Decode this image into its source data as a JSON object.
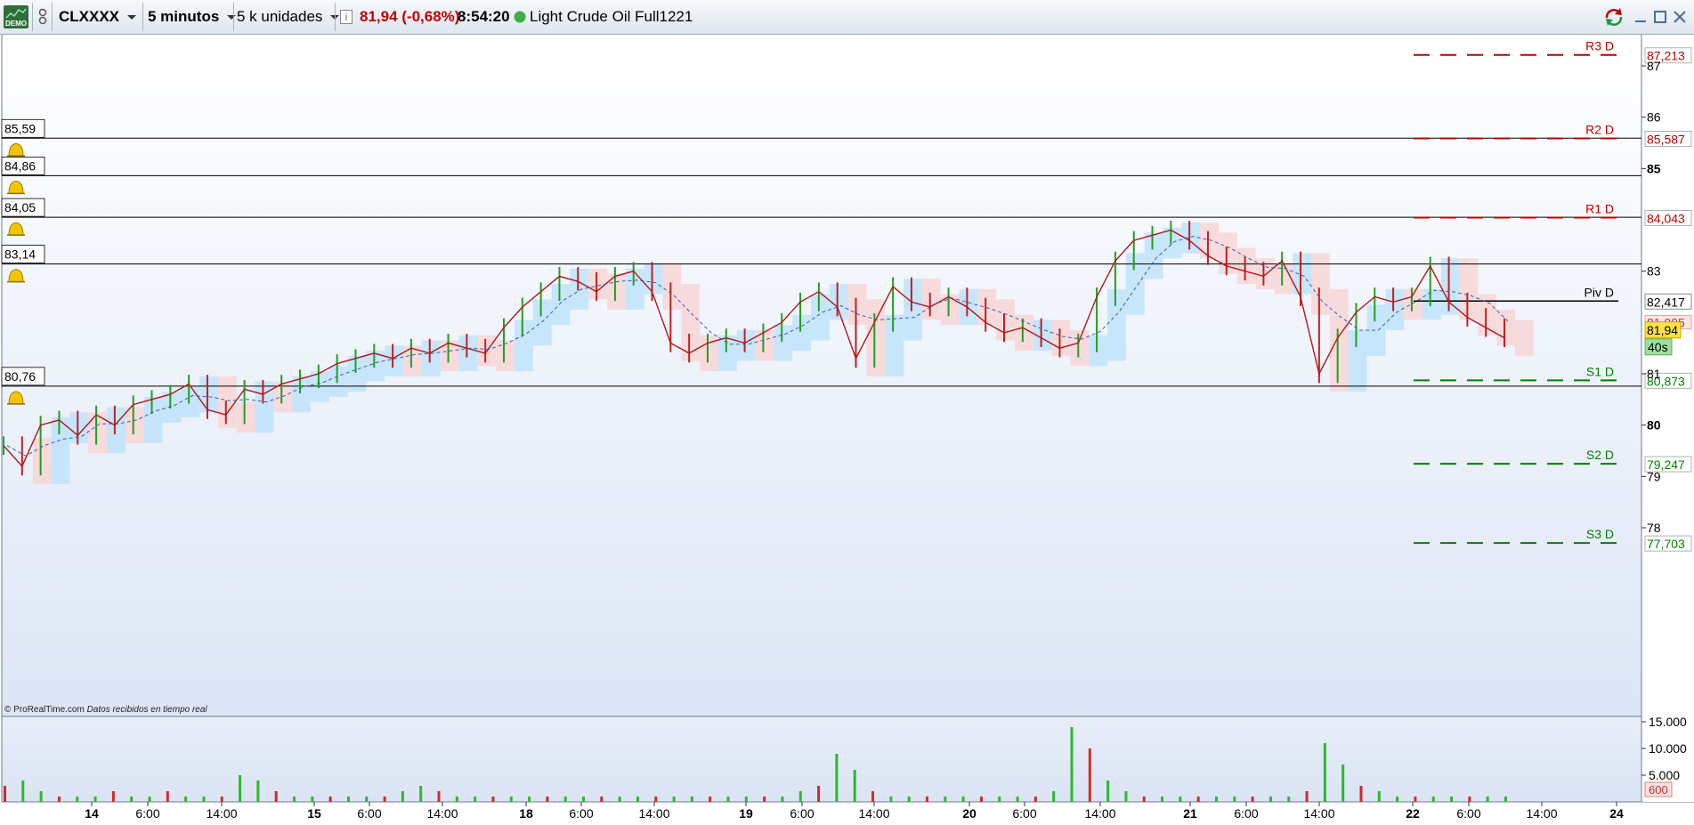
{
  "toolbar": {
    "demo_label": "DEMO",
    "symbol": "CLXXXX",
    "timeframe": "5 minutos",
    "units": "5 k unidades",
    "price_change": "81,94 (-0,68%)",
    "time": "8:54:20",
    "instrument": "Light Crude Oil Full1221",
    "accent_color": "#c00000",
    "status_color": "#3cb043"
  },
  "chart_data": {
    "type": "line",
    "title": "",
    "xlabel": "",
    "ylabel": "",
    "ylim": [
      77.0,
      87.75
    ],
    "watermark": "© ProRealTime.com",
    "watermark_note": "Datos recibidos en tiempo real",
    "x_ticks": [
      "14",
      "6:00",
      "14:00",
      "15",
      "6:00",
      "14:00",
      "18",
      "6:00",
      "14:00",
      "19",
      "6:00",
      "14:00",
      "20",
      "6:00",
      "14:00",
      "21",
      "6:00",
      "14:00",
      "22",
      "6:00",
      "14:00",
      "24"
    ],
    "x_ticks_bold": [
      "14",
      "15",
      "18",
      "19",
      "20",
      "21",
      "22",
      "24"
    ],
    "y_ticks": [
      "87",
      "86",
      "85",
      "83",
      "81",
      "80",
      "79",
      "78"
    ],
    "y_ticks_bold": [
      "85",
      "80"
    ],
    "series": [
      {
        "values": [
          79.6,
          79.2,
          80.0,
          80.1,
          79.8,
          80.2,
          80.0,
          80.4,
          80.5,
          80.6,
          80.8,
          80.3,
          80.2,
          80.7,
          80.6,
          80.8,
          80.9,
          81.0,
          81.2,
          81.3,
          81.4,
          81.3,
          81.5,
          81.4,
          81.6,
          81.5,
          81.4,
          81.9,
          82.3,
          82.6,
          82.9,
          82.8,
          82.6,
          82.9,
          83.0,
          82.6,
          81.6,
          81.4,
          81.6,
          81.7,
          81.6,
          81.8,
          82.0,
          82.4,
          82.6,
          82.3,
          81.3,
          82.0,
          82.7,
          82.4,
          82.3,
          82.5,
          82.3,
          82.0,
          81.8,
          81.9,
          81.7,
          81.5,
          81.6,
          82.5,
          83.2,
          83.6,
          83.7,
          83.8,
          83.6,
          83.3,
          83.1,
          83.0,
          82.9,
          83.2,
          82.5,
          81.0,
          81.7,
          82.2,
          82.5,
          82.4,
          82.5,
          83.1,
          82.4,
          82.1,
          81.9,
          81.7
        ]
      }
    ],
    "pivots": [
      {
        "label": "R3 D",
        "value": "87,213",
        "color": "#c00000",
        "level": 87.213
      },
      {
        "label": "R2 D",
        "value": "85,587",
        "color": "#c00000",
        "level": 85.587
      },
      {
        "label": "R1 D",
        "value": "84,043",
        "color": "#c00000",
        "level": 84.043
      },
      {
        "label": "Piv D",
        "value": "82,417",
        "color": "#000000",
        "level": 82.417
      },
      {
        "label": "S1 D",
        "value": "80,873",
        "color": "#008000",
        "level": 80.873
      },
      {
        "label": "S2 D",
        "value": "79,247",
        "color": "#008000",
        "level": 79.247
      },
      {
        "label": "S3 D",
        "value": "77,703",
        "color": "#008000",
        "level": 77.703
      }
    ],
    "alerts": [
      {
        "label": "85,59",
        "level": 85.59
      },
      {
        "label": "84,86",
        "level": 84.86
      },
      {
        "label": "84,05",
        "level": 84.05
      },
      {
        "label": "83,14",
        "level": 83.14
      },
      {
        "label": "80,76",
        "level": 80.76
      }
    ],
    "price_tags": {
      "last": "81,94",
      "countdown": "40s",
      "other": "81,995"
    },
    "volume": {
      "ylim": [
        0,
        16000
      ],
      "ticks": [
        "15.000",
        "10.000",
        "5.000"
      ],
      "last": "600",
      "values": [
        3,
        4,
        2,
        1,
        1,
        1,
        2,
        1,
        1,
        2,
        1,
        1,
        1,
        5,
        4,
        2,
        1,
        1,
        1,
        1,
        1,
        1,
        2,
        3,
        2,
        1,
        1,
        1,
        1,
        1,
        1,
        1,
        1,
        1,
        1,
        1,
        1,
        1,
        1,
        1,
        1,
        1,
        1,
        1,
        2,
        3,
        9,
        6,
        2,
        1,
        1,
        1,
        1,
        1,
        1,
        1,
        1,
        1,
        2,
        14,
        10,
        4,
        2,
        1,
        1,
        1,
        1,
        1,
        1,
        1,
        1,
        1,
        2,
        11,
        7,
        3,
        2,
        1,
        1,
        1,
        1,
        1,
        1,
        1
      ],
      "scale": 1000
    }
  }
}
